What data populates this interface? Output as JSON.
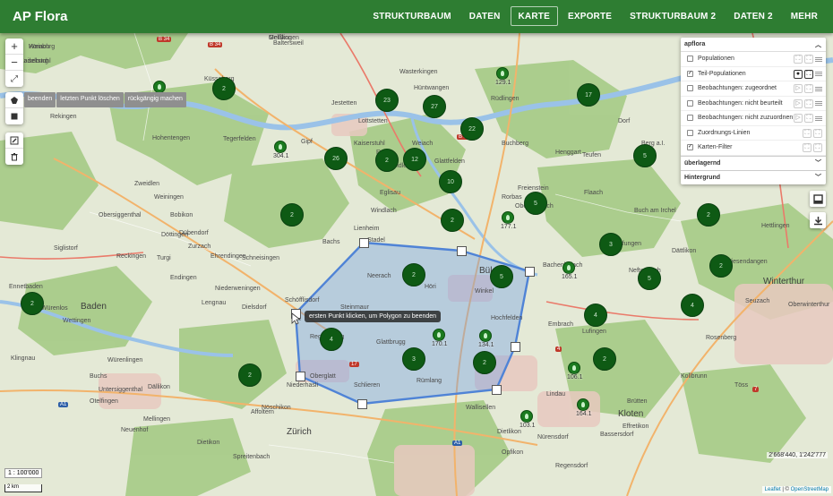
{
  "app": {
    "title": "AP Flora"
  },
  "nav": [
    {
      "label": "STRUKTURBAUM",
      "active": false
    },
    {
      "label": "DATEN",
      "active": false
    },
    {
      "label": "KARTE",
      "active": true
    },
    {
      "label": "EXPORTE",
      "active": false
    },
    {
      "label": "STRUKTURBAUM 2",
      "active": false
    },
    {
      "label": "DATEN 2",
      "active": false
    },
    {
      "label": "MEHR",
      "active": false
    }
  ],
  "map_controls": {
    "zoom_in": "+",
    "zoom_out": "−",
    "fullscreen": "⤢"
  },
  "draw_toolbar": {
    "actions": [
      "beenden",
      "letzten Punkt löschen",
      "rückgängig machen"
    ],
    "tooltip": "ersten Punkt klicken, um Polygon zu beenden"
  },
  "layers_panel": {
    "header": "apflora",
    "items": [
      {
        "label": "Populationen",
        "checked": false,
        "icons": []
      },
      {
        "label": "Teil-Populationen",
        "checked": true,
        "icons": [
          "marker-icon",
          "select-icon"
        ]
      },
      {
        "label": "Beobachtungen: zugeordnet",
        "checked": false,
        "icons": [
          "play-icon"
        ]
      },
      {
        "label": "Beobachtungen: nicht beurteilt",
        "checked": false,
        "icons": [
          "play-icon"
        ]
      },
      {
        "label": "Beobachtungen: nicht zuzuordnen",
        "checked": false,
        "icons": [
          "play-icon"
        ]
      },
      {
        "label": "Zuordnungs-Linien",
        "checked": false,
        "icons": []
      },
      {
        "label": "Karten-Filter",
        "checked": true,
        "icons": []
      }
    ],
    "overlay_header": "überlagernd",
    "background_header": "Hintergrund"
  },
  "scale": {
    "ratio": "1 : 100'000",
    "bar": "2 km"
  },
  "coordinates": "2'668'440, 1'242'777",
  "attribution": {
    "leaflet": "Leaflet",
    "sep": " | © ",
    "osm": "OpenStreetMap"
  },
  "teilpop_clusters": [
    "2",
    "23",
    "27",
    "22",
    "17",
    "26",
    "2",
    "12",
    "10",
    "5",
    "5",
    "2",
    "2",
    "3",
    "2",
    "2",
    "5",
    "4",
    "2",
    "5",
    "2",
    "4",
    "3",
    "2",
    "4",
    "2",
    "2"
  ],
  "populations": [
    {
      "label": "129.1"
    },
    {
      "label": "402.1"
    },
    {
      "label": "304.1"
    },
    {
      "label": "177.1"
    },
    {
      "label": "165.1"
    },
    {
      "label": "170.1"
    },
    {
      "label": "134.1"
    },
    {
      "label": "106.1"
    },
    {
      "label": "164.1"
    },
    {
      "label": "103.1"
    }
  ],
  "places": [
    "Hornburg",
    "Geißlingen",
    "Kadelburg",
    "Rekingen",
    "Küssaberg",
    "Baltersweil",
    "Jestetten",
    "Lottstetten",
    "Rafz",
    "Hüntwangen",
    "Wasterkingen",
    "Wil",
    "Rüdlingen",
    "Buchberg",
    "Eglisau",
    "Glattfelden",
    "Weiach",
    "Kaiserstuhl",
    "Zweidlen",
    "Bachs",
    "Stadel",
    "Windlach",
    "Schöfflisdorf",
    "Niederweningen",
    "Dielsdorf",
    "Regensberg",
    "Steinmaur",
    "Neerach",
    "Höri",
    "Bülach",
    "Hochfelden",
    "Winkel",
    "Bachenbülach",
    "Embrach",
    "Lufingen",
    "Oberembrach",
    "Rorbas",
    "Freienstein",
    "Teufen",
    "Henggart",
    "Berg a.I.",
    "Dorf",
    "Flaach",
    "Buch am Irchel",
    "Neftenbach",
    "Pfungen",
    "Dättlikon",
    "Hettlingen",
    "Seuzach",
    "Winterthur",
    "Oberwinterthur",
    "Wiesendangen",
    "Rosenberg",
    "Töss",
    "Kollbrunn",
    "Brütten",
    "Lindau",
    "Effretikon",
    "Kloten",
    "Bassersdorf",
    "Nürensdorf",
    "Dietlikon",
    "Wallisellen",
    "Opfikon",
    "Rümlang",
    "Glattbrugg",
    "Oberglatt",
    "Niederhasli",
    "Nöschikon",
    "Buchs",
    "Dällikon",
    "Otelfingen",
    "Würenlos",
    "Wettingen",
    "Baden",
    "Ennetbaden",
    "Obersiggenthal",
    "Turgi",
    "Endingen",
    "Lengnau",
    "Ehrendingen",
    "Schneisingen",
    "Siglistorf",
    "Zurzach",
    "Döttingen",
    "Klingnau",
    "Würenlingen",
    "Untersiggenthal",
    "Mellingen",
    "Neuenhof",
    "Spreitenbach",
    "Dietikon",
    "Schlieren",
    "Zürich",
    "Regensdorf",
    "Affoltern",
    "Dübendorf",
    "Weiningen",
    "Gipf",
    "Tegerfelden",
    "Hohentengen",
    "Zweidlen",
    "Lienheim",
    "Reckingen",
    "Bobikon",
    "Weiach",
    "Mellikon",
    "Kaiserstuhl"
  ]
}
